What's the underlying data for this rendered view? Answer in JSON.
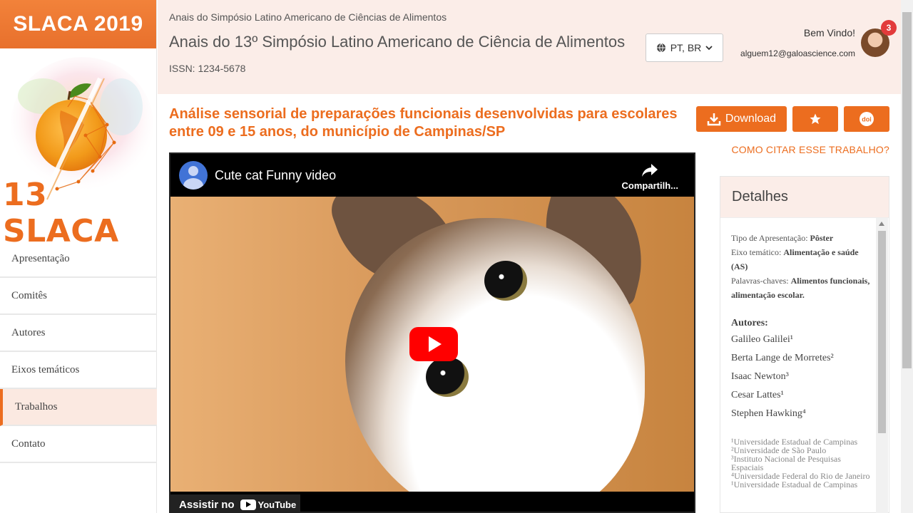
{
  "sidebar": {
    "brand": "SLACA 2019",
    "logo_text": "13 SLACA",
    "nav": [
      {
        "label": "Apresentação"
      },
      {
        "label": "Comitês"
      },
      {
        "label": "Autores"
      },
      {
        "label": "Eixos temáticos"
      },
      {
        "label": "Trabalhos",
        "active": true
      },
      {
        "label": "Contato"
      }
    ]
  },
  "header": {
    "breadcrumb": "Anais do Simpósio Latino Americano de Ciências de Alimentos",
    "title": "Anais do 13º Simpósio Latino Americano de Ciência de Alimentos",
    "issn": "ISSN: 1234-5678",
    "language": "PT, BR",
    "welcome": "Bem Vindo!",
    "email": "alguem12@galoascience.com",
    "notifications": "3"
  },
  "article": {
    "title": "Análise sensorial de preparações funcionais desenvolvidas para escolares entre 09 e 15 anos, do município de Campinas/SP",
    "download_label": "Download",
    "doi_label": "doi",
    "cite_link": "COMO CITAR ESSE TRABALHO?"
  },
  "video": {
    "title": "Cute cat Funny video",
    "share_label": "Compartilh...",
    "watch_label": "Assistir no",
    "yt_label": "YouTube"
  },
  "details": {
    "heading": "Detalhes",
    "type_label": "Tipo de Apresentação:",
    "type_value": "Pôster",
    "axis_label": "Eixo temático:",
    "axis_value": "Alimentação e saúde (AS)",
    "keywords_label": "Palavras-chaves:",
    "keywords_value": "Alimentos funcionais, alimentação escolar.",
    "authors_title": "Autores:",
    "authors": [
      "Galileo Galilei¹",
      "Berta Lange de Morretes²",
      "Isaac Newton³",
      "Cesar Lattes¹",
      "Stephen Hawking⁴"
    ],
    "affiliations": [
      "¹Universidade Estadual de Campinas",
      "²Universidade de São Paulo",
      "³Instituto Nacional de Pesquisas Espaciais",
      "⁴Universidade Federal do Rio de Janeiro",
      "¹Universidade Estadual de Campinas"
    ]
  },
  "colors": {
    "accent": "#ec6d1f",
    "header_bg": "#fbede8"
  }
}
